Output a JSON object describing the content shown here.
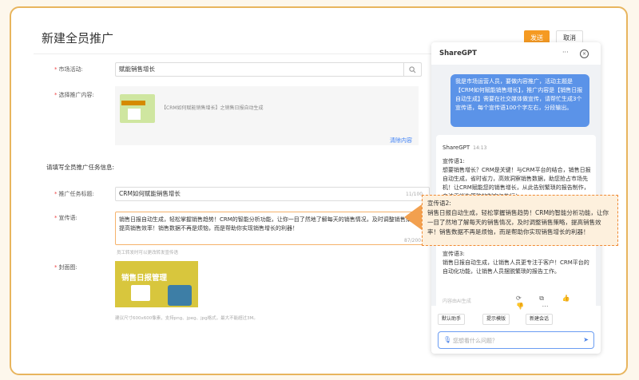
{
  "page": {
    "title": "新建全员推广",
    "send_label": "发送",
    "cancel_label": "取消"
  },
  "form": {
    "market_label": "市场活动:",
    "market_value": "赋能销售增长",
    "content_label": "选择推广内容:",
    "content_item": "【CRM如何赋能销售增长】之销售日报自动生成",
    "clear_label": "清除内容",
    "section_title": "请填写全员推广任务信息:",
    "task_label": "推广任务标题:",
    "task_value": "CRM如何赋能销售增长",
    "task_count": "11/100",
    "slogan_label": "宣传语:",
    "slogan_value": "销售日报自动生成，轻松掌握销售趋势！CRM的智能分析功能，让你一目了然地了解每天的销售情况，及时调整销售策略，提高销售效率！销售数据不再是烦恼，而是帮助你实现销售增长的利器！",
    "slogan_count": "87/200",
    "slogan_hint": "员工转发时可以更改转发宣传语",
    "cover_label": "封面图:",
    "cover_text": "销售日报管理",
    "cover_hint": "建议尺寸600x600像素，支持png、jpeg、jpg格式，最大不能超过3M。"
  },
  "panel": {
    "title": "ShareGPT",
    "user_message": "我是市场运营人员，要做内容推广，活动主题是【CRM如何赋能销售增长】，推广内容是【销售日报自动生成】需要在社交媒体做宣传，请帮忙生成3个宣传语，每个宣传语100个字左右，分段输出。",
    "ai_name": "ShareGPT",
    "ai_time": "14:13",
    "ai_text1": "宣传语1:\n想要销售增长？CRM是关键！与CRM平台的结合，销售日报自动生成，省时省力，高效洞察销售数据，助您抢占市场先机！让CRM赋能您的销售增长，从此告别繁琐的报告制作，专注于销售策略的制定与执行！",
    "ai_text3": "宣传语3:\n销售日报自动生成，让销售人员更专注于客户！CRM平台的自动化功能，让销售人员摆脱繁琐的报告工作。",
    "ai_footer": "内容由AI生成",
    "chip1": "默认助手",
    "chip2": "提示模版",
    "chip3": "新建会话",
    "ask_placeholder": "您想看什么问题？"
  },
  "highlight": "宣传语2:\n销售日报自动生成，轻松掌握销售趋势！CRM的智能分析功能，让你一目了然地了解每天的销售情况，及时调整销售策略，提高销售效率！销售数据不再是烦恼，而是帮助你实现销售增长的利器！",
  "colors": {
    "accent": "#f59a23",
    "blue": "#5b93e8",
    "highlight_border": "#f08a34"
  }
}
